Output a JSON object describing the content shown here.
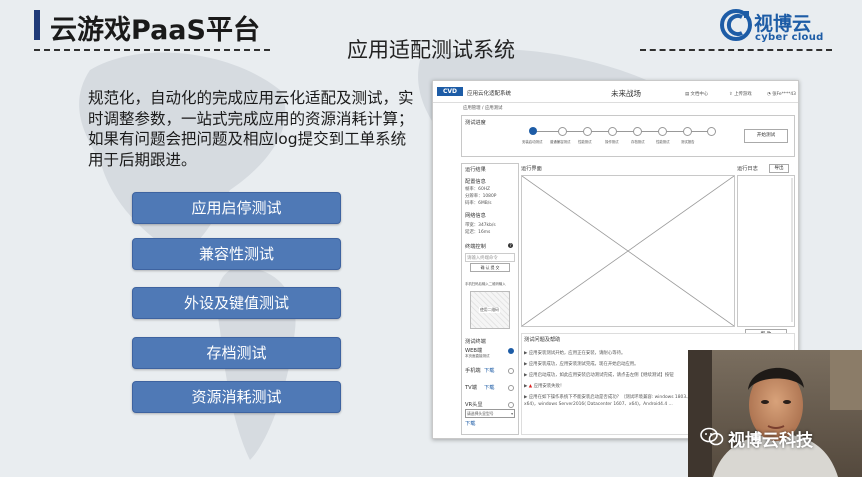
{
  "header": {
    "title": "云游戏PaaS平台",
    "subtitle": "应用适配测试系统"
  },
  "brand": {
    "name_zh": "视博云",
    "name_en": "cyber cloud",
    "color": "#1d5ca6"
  },
  "description": "规范化，自动化的完成应用云化适配及测试，实时调整参数，一站式完成应用的资源消耗计算；如果有问题会把问题及相应log提交到工单系统用于后期跟进。",
  "test_buttons": [
    "应用启停测试",
    "兼容性测试",
    "外设及键值测试",
    "存档测试",
    "资源消耗测试"
  ],
  "mock": {
    "logo_text": "CVD",
    "app_title": "应用云化适配系统",
    "game_name": "未来战场",
    "doc_center": "文档中心",
    "upload": "上传游戏",
    "user": "张Fe****43",
    "breadcrumb": "应用管理 / 应用测试",
    "progress_title": "测试进度",
    "steps": [
      "安装启动测试",
      "普通兼容测试",
      "性能测试",
      "操作测试",
      "存档测试",
      "性能测试",
      "测试报告"
    ],
    "start_button": "开始测试",
    "panel_run_result": "运行结果",
    "panel_run_screen": "运行界面",
    "panel_run_log": "运行日志",
    "export": "导出",
    "config_title": "配置信息",
    "config_lines": [
      "帧率：60HZ",
      "分辨率：1080P",
      "码率：6MB/s"
    ],
    "network_title": "网络信息",
    "network_lines": [
      "带宽：347kb/s",
      "延迟：16ms"
    ],
    "input_title": "终端控制",
    "input_placeholder": "请输入终端命令",
    "input_confirm": "确 认 提 交",
    "qr_hint": "手机扫码后输入二维码输入",
    "qr_label": "使用二维码",
    "help_button": "帮 助",
    "terminal_title": "测试终端",
    "terminals": [
      {
        "name": "WEB端",
        "sub": "本页面直接测试"
      },
      {
        "name": "手机端",
        "sub": "",
        "link": "下载"
      },
      {
        "name": "TV端",
        "sub": "",
        "link": "下载"
      },
      {
        "name": "VR头显",
        "sub": ""
      }
    ],
    "terminal_select": "请选择头显型号",
    "terminal_download": "下载",
    "feedback_title": "测试问题及帮助",
    "feedback": [
      "应用安装测试开始，应用正在安装，请耐心等待。",
      "应用安装成功，应用安装测试完成，现在开始启动应用。",
      "应用启动成功，如此应用安装启动测试完成，请点击左侧【继续测试】按钮",
      "应用安装失败！",
      "应用在如下操作系统下不能安装启动是否成功？（测试环境兼容: windows 1803、x64)，windows Server2016( Datacenter 1607、x64)，Android4.4 ..."
    ]
  },
  "watermark": "视博云科技"
}
